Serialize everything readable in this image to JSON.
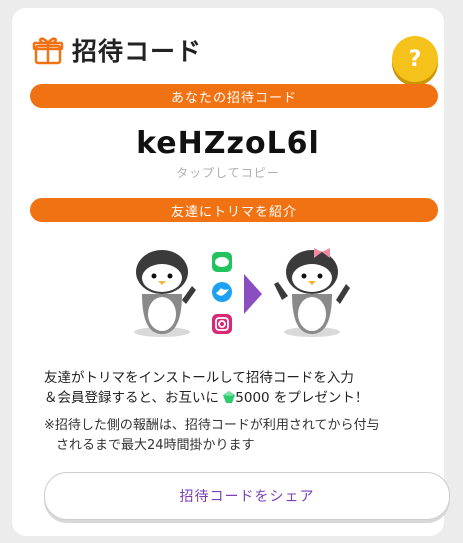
{
  "header": {
    "title": "招待コード",
    "help_label": "?"
  },
  "invite": {
    "label": "あなたの招待コード",
    "code": "keHZzoL6l",
    "hint": "タップしてコピー"
  },
  "introduce": {
    "label": "友達にトリマを紹介"
  },
  "description": {
    "line1": "友達がトリマをインストールして招待コードを入力",
    "line2_pre": "＆会員登録すると、お互いに ",
    "line2_amount": "5000",
    "line2_post": " をプレゼント！"
  },
  "note": {
    "line1": "※招待した側の報酬は、招待コードが利用されてから付与",
    "line2": "されるまで最大24時間掛かります"
  },
  "share_button": {
    "label": "招待コードをシェア"
  },
  "colors": {
    "accent": "#f07212",
    "help": "#f4c21b",
    "share_text": "#7b3fb5",
    "gem": "#2ecc71"
  },
  "icons": [
    "gift-icon",
    "line-icon",
    "twitter-icon",
    "instagram-icon",
    "arrow-right-icon",
    "gem-icon"
  ]
}
